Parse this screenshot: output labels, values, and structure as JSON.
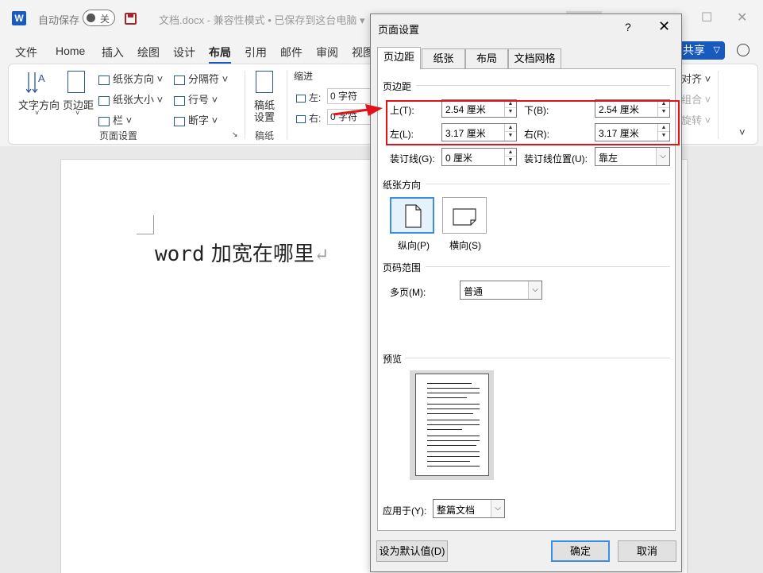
{
  "app": {
    "autosave_label": "自动保存",
    "autosave_state": "关",
    "doc_title": "文档.docx  -  兼容性模式 • 已保存到这台电脑  ▾"
  },
  "menu": [
    "文件",
    "Home",
    "插入",
    "绘图",
    "设计",
    "布局",
    "引用",
    "邮件",
    "审阅",
    "视图"
  ],
  "share_label": "共享",
  "ribbon": {
    "text_direction": "文字方向",
    "margins": "页边距",
    "orientation": "纸张方向 ˅",
    "size": "纸张大小 ˅",
    "columns": "栏 ˅",
    "breaks": "分隔符 ˅",
    "line_numbers": "行号 ˅",
    "hyphenation": "断字 ˅",
    "page_setup_group": "页面设置",
    "draft_paper_line1": "稿纸",
    "draft_paper_line2": "设置",
    "draft_group": "稿纸",
    "indent_label": "缩进",
    "indent_left_label": "左:",
    "indent_left_value": "0 字符",
    "indent_right_label": "右:",
    "indent_right_value": "0 字符",
    "align_label": "对齐 ˅",
    "group_label": "组合 ˅",
    "rotate_label": "旋转 ˅"
  },
  "document": {
    "text_latin": "word",
    "text_cjk": " 加宽在哪里",
    "para_mark": "↵"
  },
  "dialog": {
    "title": "页面设置",
    "help": "?",
    "close": "✕",
    "tabs": [
      "页边距",
      "纸张",
      "布局",
      "文档网格"
    ],
    "margins_section": "页边距",
    "top_label": "上(T):",
    "top_value": "2.54 厘米",
    "bottom_label": "下(B):",
    "bottom_value": "2.54 厘米",
    "left_label": "左(L):",
    "left_value": "3.17 厘米",
    "right_label": "右(R):",
    "right_value": "3.17 厘米",
    "gutter_label": "装订线(G):",
    "gutter_value": "0 厘米",
    "gutter_pos_label": "装订线位置(U):",
    "gutter_pos_value": "靠左",
    "orientation_section": "纸张方向",
    "portrait_label": "纵向(P)",
    "landscape_label": "横向(S)",
    "pages_section": "页码范围",
    "multiple_pages_label": "多页(M):",
    "multiple_pages_value": "普通",
    "preview_section": "预览",
    "apply_to_label": "应用于(Y):",
    "apply_to_value": "整篇文档",
    "set_default": "设为默认值(D)",
    "ok": "确定",
    "cancel": "取消"
  },
  "annotation": {
    "highlight_color": "#e0131b"
  }
}
